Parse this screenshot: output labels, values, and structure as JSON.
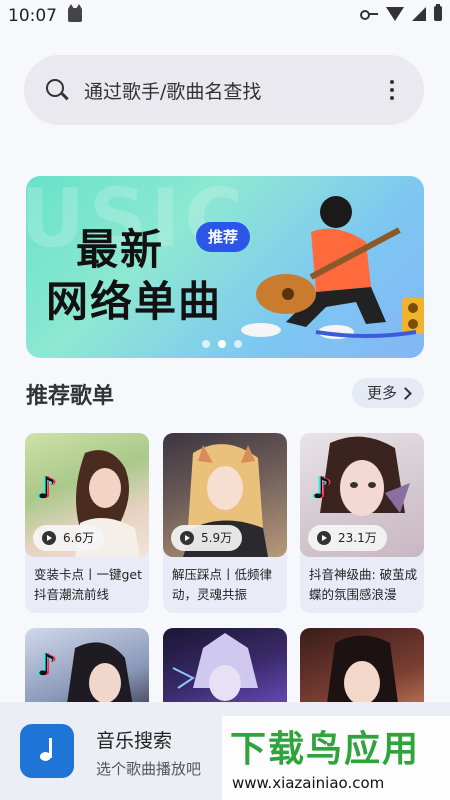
{
  "status_bar": {
    "time": "10:07"
  },
  "search": {
    "placeholder": "通过歌手/歌曲名查找"
  },
  "banner": {
    "bg_text": "USIC",
    "title_line1": "最新",
    "title_line2": "网络单曲",
    "tag": "推荐",
    "slides": 3,
    "active_slide": 2
  },
  "section": {
    "title": "推荐歌单",
    "more_label": "更多"
  },
  "playlists": [
    {
      "plays": "6.6万",
      "desc": "变装卡点丨一键get抖音潮流前线"
    },
    {
      "plays": "5.9万",
      "desc": "解压踩点丨低频律动，灵魂共振"
    },
    {
      "plays": "23.1万",
      "desc": "抖音神级曲: 破茧成蝶的氛围感浪漫"
    }
  ],
  "bottom_app": {
    "name": "音乐搜索",
    "subtitle": "选个歌曲播放吧"
  },
  "watermark": {
    "text": "下载鸟应用",
    "url": "www.xiazainiao.com"
  },
  "colors": {
    "accent": "#1f74d8",
    "banner_tag": "#2c56e8",
    "watermark_green": "#2fa33c"
  }
}
